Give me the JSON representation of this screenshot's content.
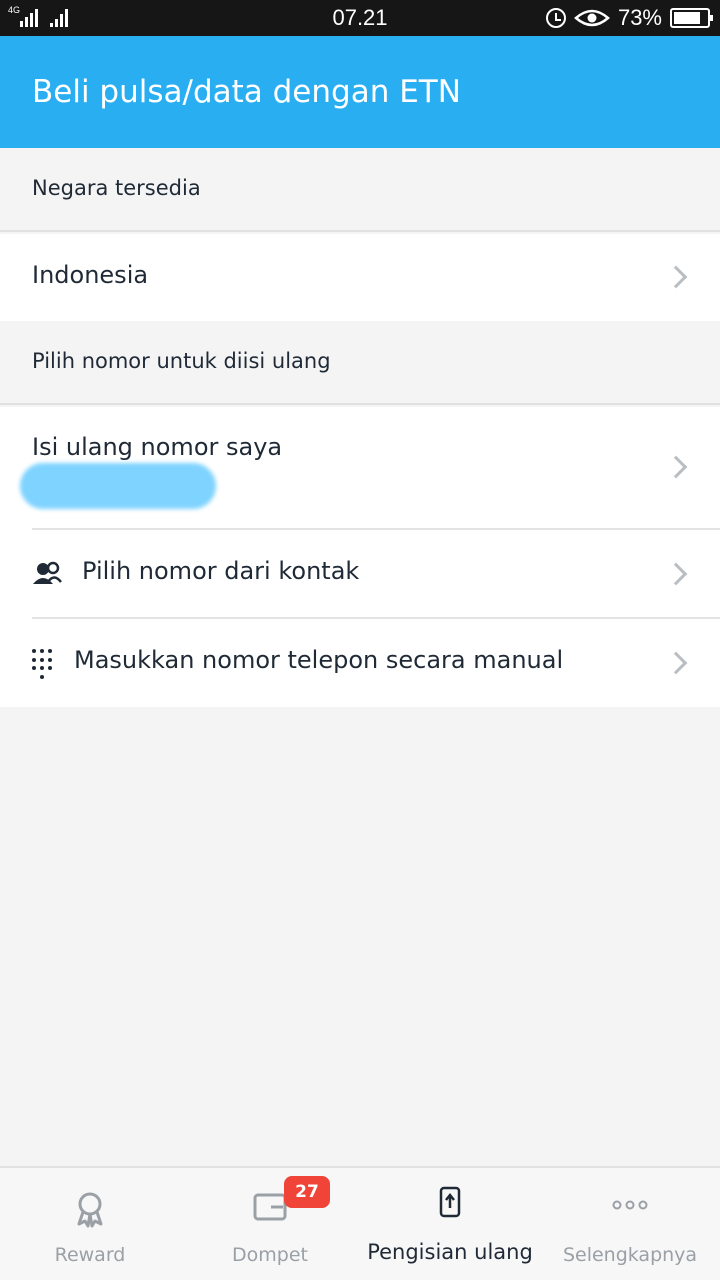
{
  "status_bar": {
    "network": "4G",
    "time": "07.21",
    "battery": "73%"
  },
  "app_bar": {
    "title": "Beli pulsa/data dengan ETN"
  },
  "sections": {
    "country_header": "Negara tersedia",
    "country_value": "Indonesia",
    "number_header": "Pilih nomor untuk diisi ulang",
    "own_number": "Isi ulang nomor saya",
    "from_contacts": "Pilih nomor dari kontak",
    "manual_entry": "Masukkan nomor telepon secara manual"
  },
  "bottom_nav": {
    "items": [
      {
        "label": "Reward",
        "icon": "reward-icon"
      },
      {
        "label": "Dompet",
        "icon": "wallet-icon",
        "badge": "27"
      },
      {
        "label": "Pengisian ulang",
        "icon": "recharge-icon",
        "active": true
      },
      {
        "label": "Selengkapnya",
        "icon": "more-icon"
      }
    ]
  },
  "colors": {
    "accent": "#2aaef2",
    "badge": "#f04438"
  }
}
